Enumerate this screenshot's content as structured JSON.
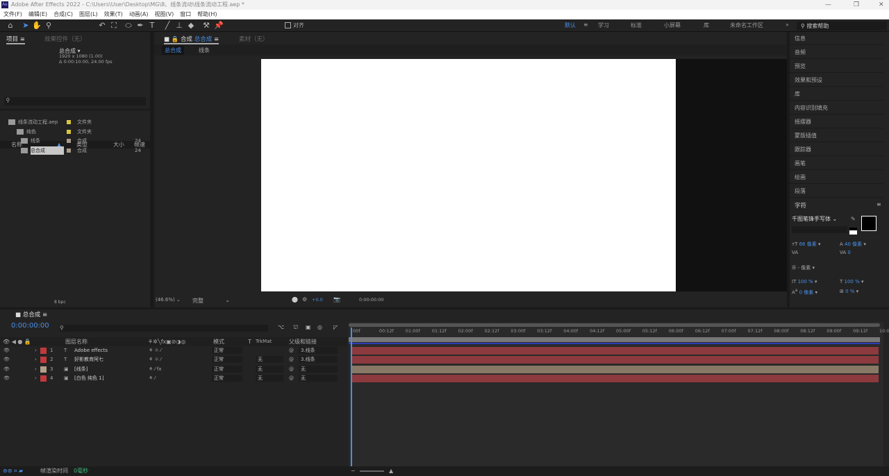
{
  "window": {
    "title": "Adobe After Effects 2022 - C:\\Users\\User\\Desktop\\MG\\8、线条流动\\线条流动工程.aep *",
    "app_icon": "Ae"
  },
  "menu": [
    "文件(F)",
    "编辑(E)",
    "合成(C)",
    "图层(L)",
    "效果(T)",
    "动画(A)",
    "视图(V)",
    "窗口",
    "帮助(H)"
  ],
  "toolbar": {
    "snap_label": "对齐",
    "workspaces": [
      "默认",
      "学习",
      "标准",
      "小屏幕",
      "库",
      "未命名工作区"
    ],
    "help_placeholder": "搜索帮助"
  },
  "project": {
    "tab": "项目",
    "tab2": "效果控件（无）",
    "comp_name": "总合成 ▾",
    "comp_size": "1920 x 1080 (1.00)",
    "comp_duration": "Δ 0:00:10:00, 24.00 fps",
    "columns": [
      "名称",
      "类型",
      "大小",
      "帧速"
    ],
    "items": [
      {
        "name": "线条流动工程.aep",
        "type": "文件夹",
        "rate": ""
      },
      {
        "name": "纯色",
        "type": "文件夹",
        "rate": ""
      },
      {
        "name": "线条",
        "type": "合成",
        "rate": "24"
      },
      {
        "name": "总合成",
        "type": "合成",
        "rate": "24"
      }
    ],
    "bpc": "8 bpc"
  },
  "composition": {
    "tab_prefix": "合成",
    "tab_name": "总合成",
    "footage_tab": "素材（无）",
    "breadcrumb": [
      "总合成",
      "线条"
    ],
    "zoom": "(46.6%)",
    "resolution": "完整",
    "exposure": "+0.0",
    "timecode": "0:00:00:00"
  },
  "right_panels": [
    "信息",
    "音频",
    "预览",
    "效果和预设",
    "库",
    "内容识别填充",
    "摇摆器",
    "蒙版插值",
    "跟踪器",
    "画笔",
    "绘画",
    "段落"
  ],
  "character": {
    "title": "字符",
    "font": "千图笔锋手写体",
    "font_size": "66 像素",
    "leading": "40 像素",
    "kerning": "",
    "tracking": "0",
    "stroke": "- 像素",
    "vscale": "100 %",
    "hscale": "100 %",
    "baseline": "0 像素",
    "tsume": "0 %"
  },
  "timeline": {
    "tab": "总合成",
    "timecode": "0:00:00:00",
    "columns": [
      "图层名称",
      "模式",
      "T",
      "TrkMat",
      "父级和链接"
    ],
    "layers": [
      {
        "num": "1",
        "name": "Adobe effects",
        "mode": "正常",
        "trkmat": "",
        "parent": "3.线条",
        "color": "#c0393c"
      },
      {
        "num": "2",
        "name": "好影教育阿七",
        "mode": "正常",
        "trkmat": "无",
        "parent": "3.线条",
        "color": "#c0393c"
      },
      {
        "num": "3",
        "name": "[线条]",
        "mode": "正常",
        "trkmat": "无",
        "parent": "无",
        "color": "#b0a08a"
      },
      {
        "num": "4",
        "name": "[白色 纯色 1]",
        "mode": "正常",
        "trkmat": "无",
        "parent": "无",
        "color": "#c0393c"
      }
    ],
    "ruler": [
      "00f",
      "00:12f",
      "01:00f",
      "01:12f",
      "02:00f",
      "02:12f",
      "03:00f",
      "03:12f",
      "04:00f",
      "04:12f",
      "05:00f",
      "05:12f",
      "06:00f",
      "06:12f",
      "07:00f",
      "07:12f",
      "08:00f",
      "08:12f",
      "09:00f",
      "09:12f",
      "10:0"
    ]
  },
  "status": {
    "render_label": "帧渲染时间",
    "render_value": "0毫秒"
  }
}
